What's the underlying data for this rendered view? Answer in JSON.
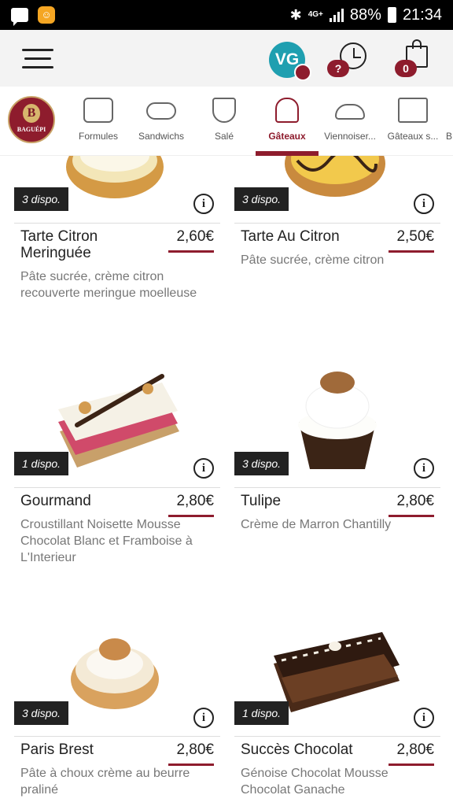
{
  "status_bar": {
    "network": "4G+",
    "battery": "88%",
    "time": "21:34"
  },
  "header": {
    "avatar_initials": "VG",
    "help_badge": "?",
    "cart_count": "0"
  },
  "brand": {
    "logo_letter": "B",
    "logo_text": "BAGUÉPI"
  },
  "categories": [
    {
      "label": "Formules",
      "icon": "combo-meal-icon"
    },
    {
      "label": "Sandwichs",
      "icon": "sandwich-icon"
    },
    {
      "label": "Salé",
      "icon": "pizza-slice-icon"
    },
    {
      "label": "Gâteaux",
      "icon": "cupcake-icon",
      "active": true
    },
    {
      "label": "Viennoiser...",
      "icon": "croissant-icon"
    },
    {
      "label": "Gâteaux s...",
      "icon": "layer-cake-icon"
    },
    {
      "label": "B",
      "icon": "more-icon"
    }
  ],
  "products": [
    {
      "dispo": "3 dispo.",
      "name": "Tarte Citron Meringuée",
      "price": "2,60€",
      "description": "Pâte sucrée, crème citron recouverte meringue moelleuse",
      "image": "lemon-meringue-tart"
    },
    {
      "dispo": "3 dispo.",
      "name": "Tarte Au Citron",
      "price": "2,50€",
      "description": "Pâte sucrée, crème citron",
      "image": "lemon-tart"
    },
    {
      "dispo": "1 dispo.",
      "name": "Gourmand",
      "price": "2,80€",
      "description": "Croustillant Noisette Mousse Chocolat Blanc et Framboise à L'Interieur",
      "image": "gourmand-cake"
    },
    {
      "dispo": "3 dispo.",
      "name": "Tulipe",
      "price": "2,80€",
      "description": "Crème de Marron Chantilly",
      "image": "tulipe-cake"
    },
    {
      "dispo": "3 dispo.",
      "name": "Paris Brest",
      "price": "2,80€",
      "description": "Pâte à choux crème au beurre praliné",
      "image": "paris-brest"
    },
    {
      "dispo": "1 dispo.",
      "name": "Succès Chocolat",
      "price": "2,80€",
      "description": "Génoise Chocolat Mousse Chocolat Ganache",
      "image": "chocolate-success-cake"
    }
  ],
  "info_glyph": "i",
  "colors": {
    "accent": "#8e1c2d",
    "avatar": "#1f9fb0",
    "topbar_bg": "#f3f3f3"
  }
}
